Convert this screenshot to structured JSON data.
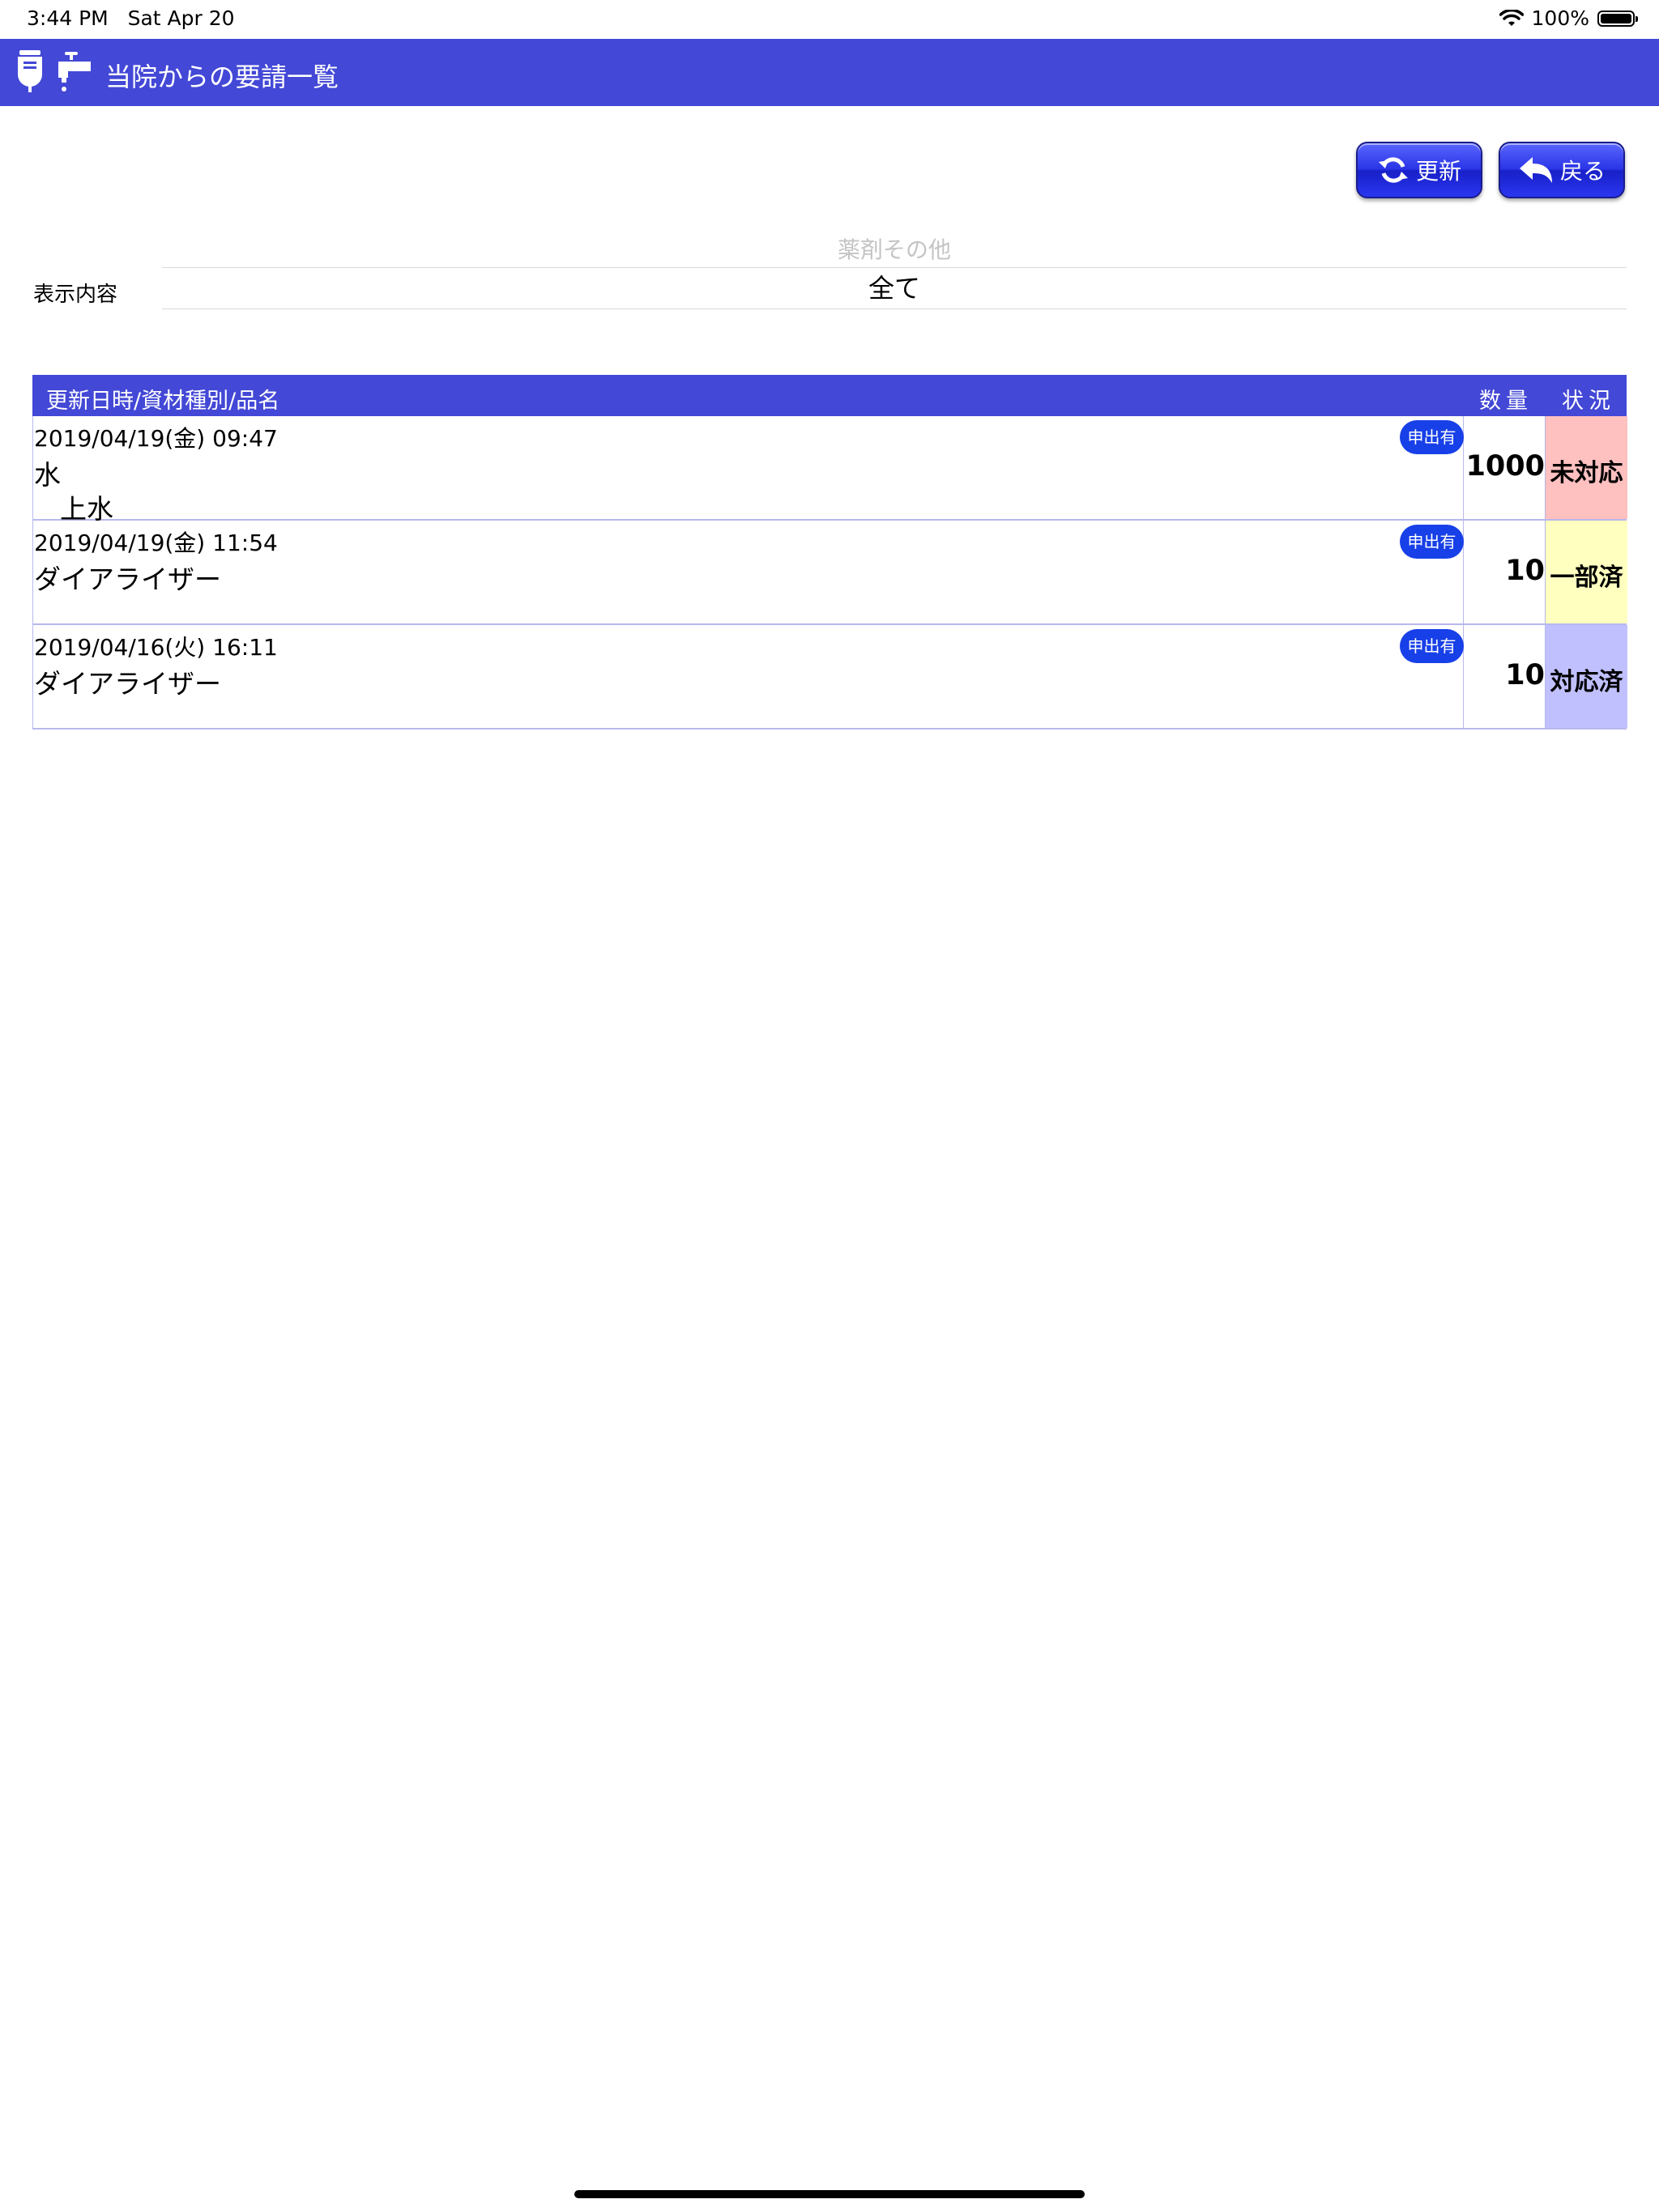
{
  "status_bar": {
    "time": "3:44 PM",
    "date": "Sat Apr 20",
    "battery": "100%"
  },
  "nav": {
    "title": "当院からの要請一覧",
    "icons": [
      "iv-bag-icon",
      "faucet-icon"
    ]
  },
  "toolbar": {
    "refresh_label": "更新",
    "back_label": "戻る"
  },
  "filter": {
    "label": "表示内容",
    "picker_above": "薬剤その他",
    "picker_selected": "全て"
  },
  "table": {
    "headers": {
      "main": "更新日時/資材種別/品名",
      "qty": "数量",
      "status": "状況"
    },
    "rows": [
      {
        "date": "2019/04/19(金) 09:47",
        "category": "水",
        "item": "上水",
        "badge": "申出有",
        "qty": "1000",
        "status": "未対応",
        "status_color": "#ffc0c0"
      },
      {
        "date": "2019/04/19(金) 11:54",
        "category": "ダイアライザー",
        "item": "",
        "badge": "申出有",
        "qty": "10",
        "status": "一部済",
        "status_color": "#ffffc0"
      },
      {
        "date": "2019/04/16(火) 16:11",
        "category": "ダイアライザー",
        "item": "",
        "badge": "申出有",
        "qty": "10",
        "status": "対応済",
        "status_color": "#c0c0ff"
      }
    ]
  },
  "colors": {
    "nav_bar": "#4348d6",
    "badge": "#1840e8"
  }
}
